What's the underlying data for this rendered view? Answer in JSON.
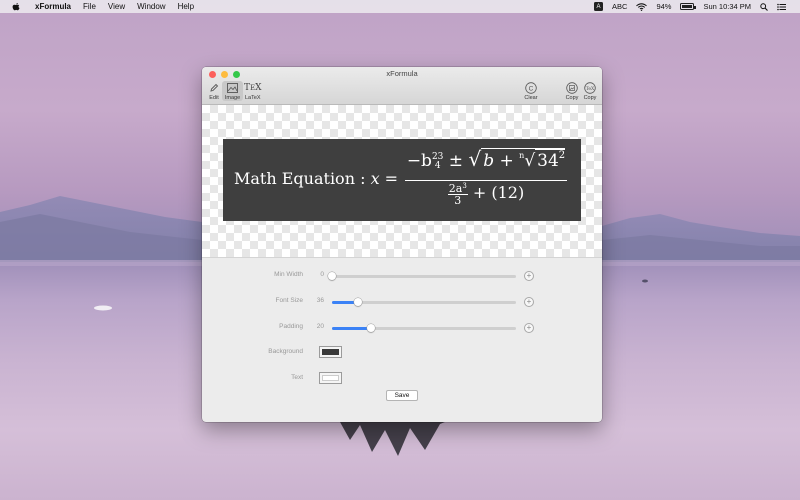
{
  "menubar": {
    "app_name": "xFormula",
    "menus": [
      "File",
      "View",
      "Window",
      "Help"
    ],
    "input_badge": "A",
    "input_source": "ABC",
    "battery_percent": "94%",
    "battery_level": 0.94,
    "clock": "Sun 10:34 PM"
  },
  "window": {
    "title": "xFormula",
    "toolbar": {
      "edit_label": "Edit",
      "image_label": "Image",
      "latex_label": "LaTeX",
      "clear_label": "Clear",
      "copy_image_label": "Copy",
      "copy_tex_label": "Copy"
    },
    "equation": {
      "prefix": "Math Equation : ",
      "x": "x",
      "equals": " = ",
      "num_minus_b": "−b",
      "num_b_sup": "23",
      "num_b_sub": "4",
      "num_pm": " ± ",
      "num_sqrt_b": "b + ",
      "num_root_index": "n",
      "num_inner": "34",
      "num_inner_sup": "2",
      "den_2a": "2a",
      "den_a_sup": "3",
      "den_three": "3",
      "den_rest": " + (12)",
      "bg_color": "#3f3f3f",
      "text_color": "#ffffff"
    },
    "settings": {
      "min_width": {
        "label": "Min Width",
        "value": "0",
        "fraction": 0.0
      },
      "font_size": {
        "label": "Font Size",
        "value": "36",
        "fraction": 0.14
      },
      "padding": {
        "label": "Padding",
        "value": "20",
        "fraction": 0.21
      },
      "background": {
        "label": "Background",
        "color": "#3a3a3a"
      },
      "text": {
        "label": "Text",
        "color": "#ffffff"
      },
      "save_label": "Save"
    }
  },
  "colors": {
    "close": "#fc605c",
    "minimize": "#fdbc40",
    "zoom": "#34c84a",
    "accent": "#3b82f6"
  }
}
